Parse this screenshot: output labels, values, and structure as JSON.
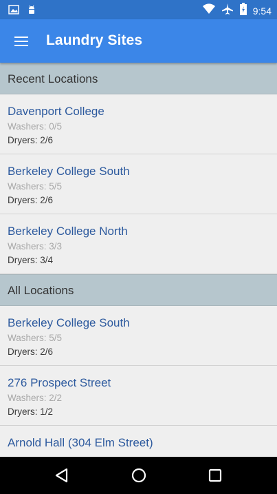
{
  "status_bar": {
    "time": "9:54",
    "icons_left": [
      "image-icon",
      "android-icon"
    ],
    "icons_right": [
      "wifi-icon",
      "airplane-icon",
      "battery-icon"
    ]
  },
  "app_bar": {
    "title": "Laundry Sites",
    "menu_icon": "hamburger-menu-icon"
  },
  "sections": [
    {
      "header": "Recent Locations",
      "items": [
        {
          "name": "Davenport College",
          "washers": "Washers: 0/5",
          "dryers": "Dryers: 2/6"
        },
        {
          "name": "Berkeley College South",
          "washers": "Washers: 5/5",
          "dryers": "Dryers: 2/6"
        },
        {
          "name": "Berkeley College North",
          "washers": "Washers: 3/3",
          "dryers": "Dryers: 3/4"
        }
      ]
    },
    {
      "header": "All Locations",
      "items": [
        {
          "name": "Berkeley College South",
          "washers": "Washers: 5/5",
          "dryers": "Dryers: 2/6"
        },
        {
          "name": "276 Prospect Street",
          "washers": "Washers: 2/2",
          "dryers": "Dryers: 1/2"
        },
        {
          "name": "Arnold Hall (304 Elm Street)",
          "washers": "",
          "dryers": ""
        }
      ]
    }
  ],
  "nav_bar": {
    "buttons": [
      "back-icon",
      "home-icon",
      "recents-icon"
    ]
  },
  "colors": {
    "status_bar": "#2f73c8",
    "app_bar": "#3b86e8",
    "section_header": "#b6c6cd",
    "item_name": "#2d5a9e"
  }
}
